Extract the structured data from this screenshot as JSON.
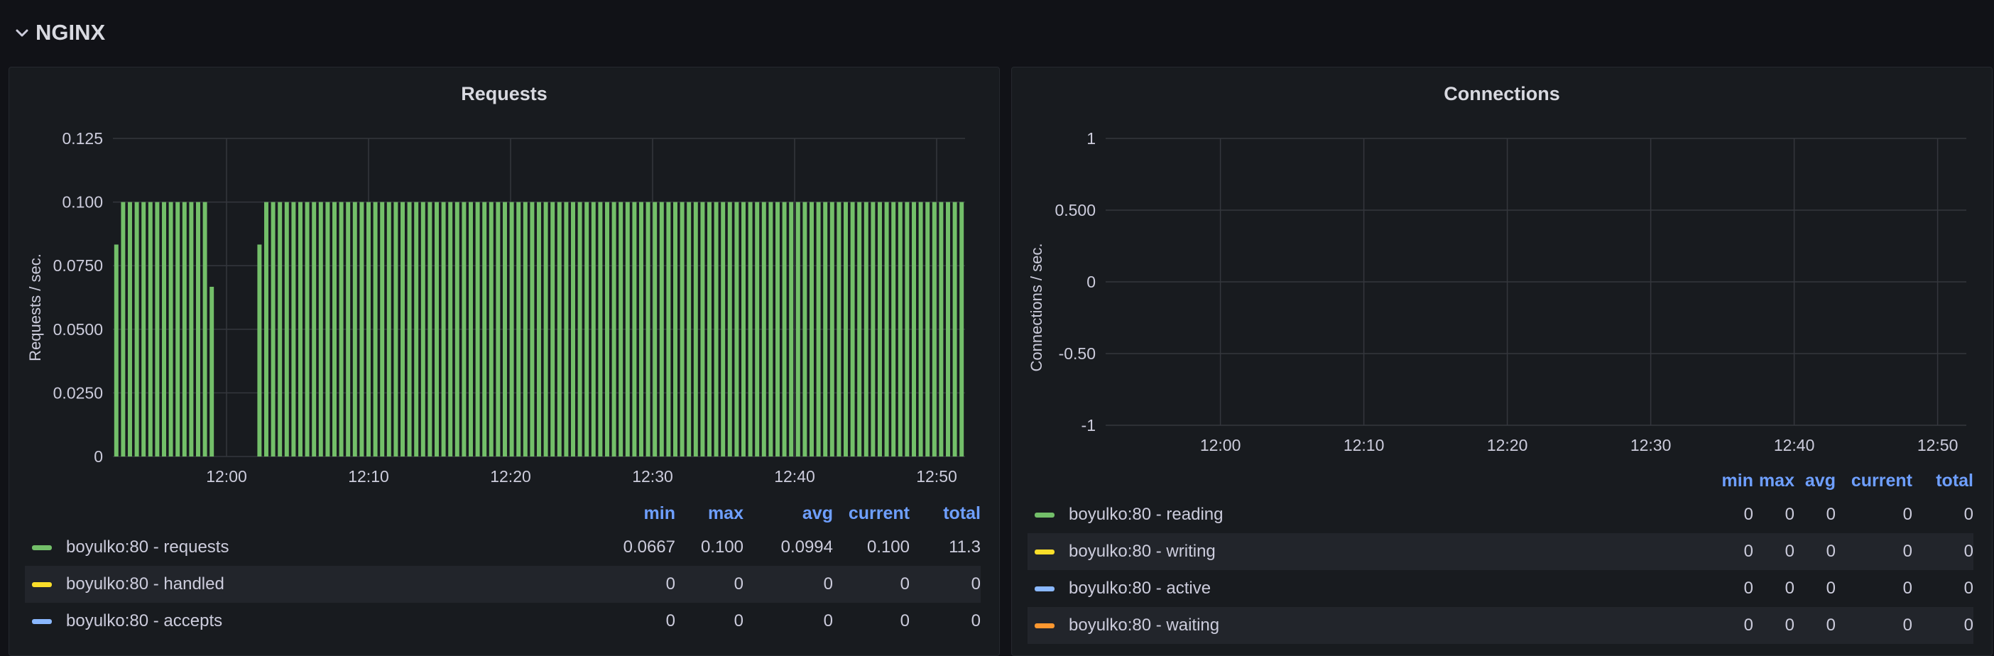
{
  "row": {
    "title": "NGINX"
  },
  "panels": {
    "requests": {
      "title": "Requests",
      "ylabel": "Requests / sec.",
      "yticks": [
        "0.125",
        "0.100",
        "0.0750",
        "0.0500",
        "0.0250",
        "0"
      ],
      "xticks": [
        "12:00",
        "12:10",
        "12:20",
        "12:30",
        "12:40",
        "12:50"
      ],
      "legend": {
        "columns": [
          "min",
          "max",
          "avg",
          "current",
          "total"
        ],
        "rows": [
          {
            "name": "boyulko:80 - requests",
            "color": "#73bf69",
            "values": [
              "0.0667",
              "0.100",
              "0.0994",
              "0.100",
              "11.3"
            ]
          },
          {
            "name": "boyulko:80 - handled",
            "color": "#fade2a",
            "values": [
              "0",
              "0",
              "0",
              "0",
              "0"
            ]
          },
          {
            "name": "boyulko:80 - accepts",
            "color": "#8ab8ff",
            "values": [
              "0",
              "0",
              "0",
              "0",
              "0"
            ]
          }
        ]
      }
    },
    "connections": {
      "title": "Connections",
      "ylabel": "Connections / sec.",
      "yticks": [
        "1",
        "0.500",
        "0",
        "-0.50",
        "-1"
      ],
      "xticks": [
        "12:00",
        "12:10",
        "12:20",
        "12:30",
        "12:40",
        "12:50"
      ],
      "legend": {
        "columns": [
          "min",
          "max",
          "avg",
          "current",
          "total"
        ],
        "rows": [
          {
            "name": "boyulko:80 - reading",
            "color": "#73bf69",
            "values": [
              "0",
              "0",
              "0",
              "0",
              "0"
            ]
          },
          {
            "name": "boyulko:80 - writing",
            "color": "#fade2a",
            "values": [
              "0",
              "0",
              "0",
              "0",
              "0"
            ]
          },
          {
            "name": "boyulko:80 - active",
            "color": "#8ab8ff",
            "values": [
              "0",
              "0",
              "0",
              "0",
              "0"
            ]
          },
          {
            "name": "boyulko:80 - waiting",
            "color": "#ff9830",
            "values": [
              "0",
              "0",
              "0",
              "0",
              "0"
            ]
          }
        ]
      }
    }
  },
  "chart_data": [
    {
      "type": "bar",
      "title": "Requests",
      "ylabel": "Requests / sec.",
      "xlabel": "",
      "ylim": [
        0,
        0.125
      ],
      "x_time_range": [
        "11:52",
        "12:52"
      ],
      "grid": true,
      "series": [
        {
          "name": "boyulko:80 - requests",
          "color": "#73bf69",
          "values": [
            0.0833,
            0.1,
            0.1,
            0.1,
            0.1,
            0.1,
            0.1,
            0.1,
            0.1,
            0.1,
            0.1,
            0.1,
            0.1,
            0.1,
            0.0667,
            0,
            0,
            0,
            0,
            0,
            0,
            0.0833,
            0.1,
            0.1,
            0.1,
            0.1,
            0.1,
            0.1,
            0.1,
            0.1,
            0.1,
            0.1,
            0.1,
            0.1,
            0.1,
            0.1,
            0.1,
            0.1,
            0.1,
            0.1,
            0.1,
            0.1,
            0.1,
            0.1,
            0.1,
            0.1,
            0.1,
            0.1,
            0.1,
            0.1,
            0.1,
            0.1,
            0.1,
            0.1,
            0.1,
            0.1,
            0.1,
            0.1,
            0.1,
            0.1,
            0.1,
            0.1,
            0.1,
            0.1,
            0.1,
            0.1,
            0.1,
            0.1,
            0.1,
            0.1,
            0.1,
            0.1,
            0.1,
            0.1,
            0.1,
            0.1,
            0.1,
            0.1,
            0.1,
            0.1,
            0.1,
            0.1,
            0.1,
            0.1,
            0.1,
            0.1,
            0.1,
            0.1,
            0.1,
            0.1,
            0.1,
            0.1,
            0.1,
            0.1,
            0.1,
            0.1,
            0.1,
            0.1,
            0.1,
            0.1,
            0.1,
            0.1,
            0.1,
            0.1,
            0.1,
            0.1,
            0.1,
            0.1,
            0.1,
            0.1,
            0.1,
            0.1,
            0.1,
            0.1,
            0.1,
            0.1,
            0.1,
            0.1,
            0.1,
            0.1,
            0.1,
            0.1,
            0.1,
            0.1,
            0.1
          ]
        }
      ]
    },
    {
      "type": "line",
      "title": "Connections",
      "ylabel": "Connections / sec.",
      "xlabel": "",
      "ylim": [
        -1,
        1
      ],
      "x_time_range": [
        "11:52",
        "12:52"
      ],
      "grid": true,
      "series": []
    }
  ]
}
